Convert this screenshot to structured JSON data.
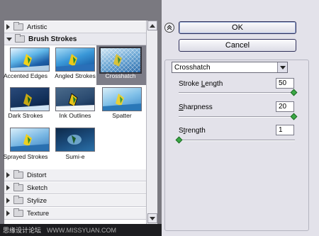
{
  "categories": {
    "artistic": "Artistic",
    "brush_strokes": "Brush Strokes",
    "distort": "Distort",
    "sketch": "Sketch",
    "stylize": "Stylize",
    "texture": "Texture"
  },
  "thumbnails": [
    {
      "label": "Accented Edges"
    },
    {
      "label": "Angled Strokes"
    },
    {
      "label": "Crosshatch",
      "selected": true
    },
    {
      "label": "Dark Strokes"
    },
    {
      "label": "Ink Outlines"
    },
    {
      "label": "Spatter"
    },
    {
      "label": "Sprayed Strokes"
    },
    {
      "label": "Sumi-e"
    }
  ],
  "buttons": {
    "ok": "OK",
    "cancel": "Cancel"
  },
  "filter_select": {
    "value": "Crosshatch"
  },
  "params": {
    "stroke_length": {
      "label_pre": "Stroke ",
      "label_u": "L",
      "label_post": "ength",
      "value": "50",
      "level": 1.0
    },
    "sharpness": {
      "label_pre": "",
      "label_u": "S",
      "label_post": "harpness",
      "value": "20",
      "level": 1.0
    },
    "strength": {
      "label_pre": "S",
      "label_u": "t",
      "label_post": "rength",
      "value": "1",
      "level": 0.0
    }
  },
  "watermark": {
    "left": "思缘设计论坛",
    "right": "WWW.MISSYUAN.COM"
  },
  "colors": {
    "slider_knob": "#3aa845",
    "selected_bg": "#7d7d88",
    "panel_bg": "#e3e2ea"
  }
}
